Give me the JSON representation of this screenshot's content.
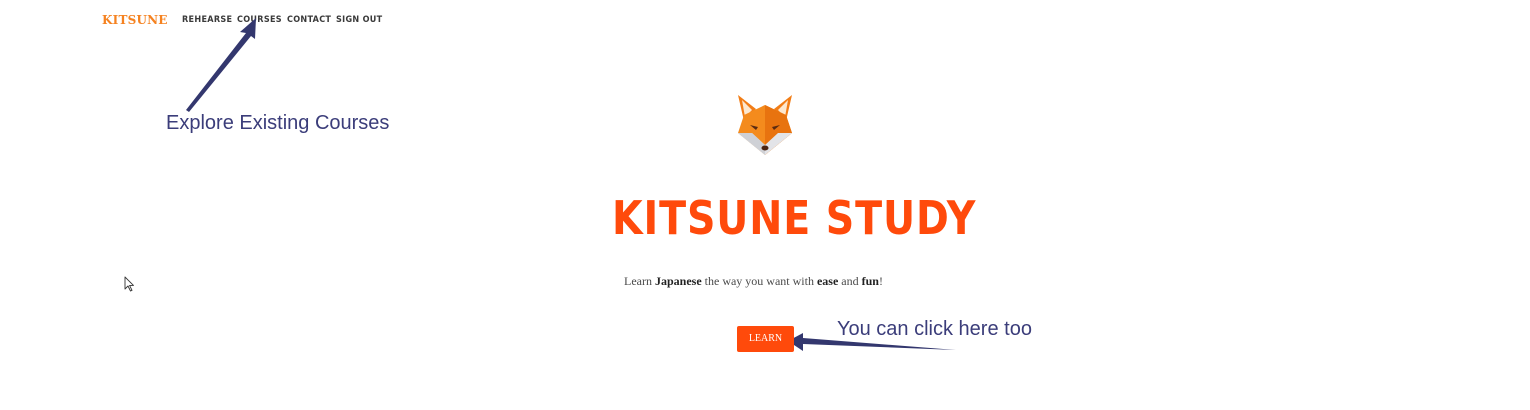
{
  "nav": {
    "brand": "KITSUNE",
    "links": [
      "REHEARSE",
      "COURSES",
      "CONTACT",
      "SIGN OUT"
    ]
  },
  "hero": {
    "logo_icon": "fox-head-icon",
    "title": "KITSUNE STUDY",
    "tagline": {
      "part1": "Learn ",
      "bold1": "Japanese",
      "part2": " the way you want with ",
      "bold2": "ease",
      "part3": " and ",
      "bold3": "fun",
      "part4": "!"
    },
    "button_label": "LEARN"
  },
  "annotations": {
    "courses_note": "Explore Existing Courses",
    "learn_note": "You can click here too"
  },
  "colors": {
    "brand_orange": "#f58220",
    "accent_red_orange": "#ff4a0b",
    "annotation_navy": "#3b3d7a",
    "nav_text": "#3a3a3a"
  },
  "icons": [
    "fox-head-icon",
    "mouse-pointer-icon",
    "annotation-arrow-icon"
  ]
}
